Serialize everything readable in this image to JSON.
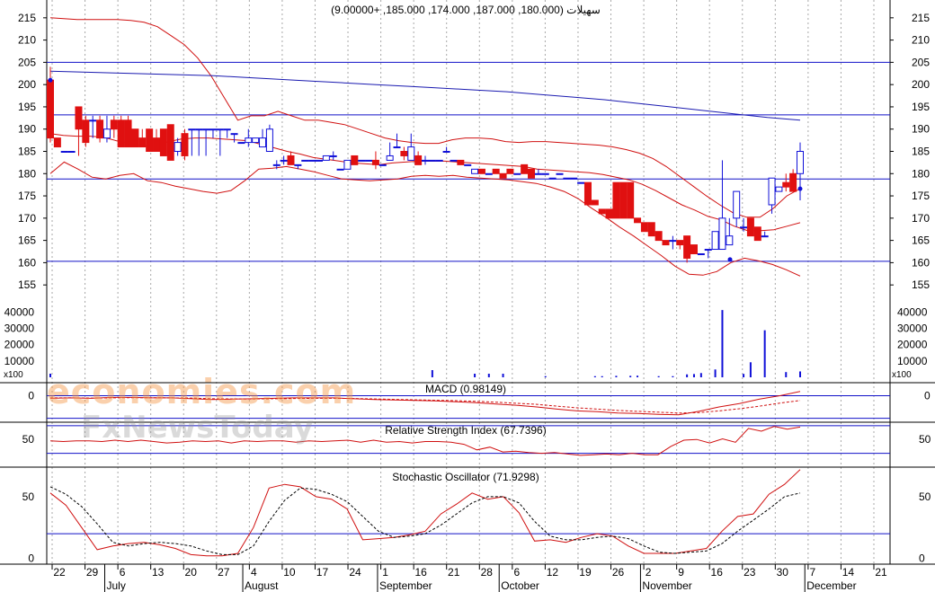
{
  "chart_data": {
    "type": "candlestick",
    "title": "سهیلات (180.000, 187.000, 174.000, 185.000, +9.00000)",
    "price": {
      "ylim": [
        151,
        219
      ],
      "ticks": [
        155,
        160,
        165,
        170,
        175,
        180,
        185,
        190,
        195,
        200,
        205,
        210,
        215
      ],
      "hlines": [
        205,
        193.2,
        178.8,
        160.3
      ],
      "candles": [
        [
          201,
          204,
          187,
          188
        ],
        [
          188,
          188,
          186,
          186
        ],
        [
          185,
          185,
          185,
          185
        ],
        [
          185,
          185,
          185,
          185
        ],
        [
          195,
          195,
          184,
          190
        ],
        [
          192,
          193,
          186,
          187
        ],
        [
          192,
          193,
          188,
          192
        ],
        [
          192,
          193,
          187,
          188
        ],
        [
          188,
          193,
          187,
          190
        ],
        [
          192,
          193,
          188,
          190
        ],
        [
          192,
          193,
          186,
          186
        ],
        [
          192,
          193,
          186,
          186
        ],
        [
          190,
          190,
          186,
          186
        ],
        [
          188,
          190,
          186,
          186
        ],
        [
          190,
          190,
          185,
          185
        ],
        [
          188,
          190,
          185,
          185
        ],
        [
          190,
          190,
          184,
          184
        ],
        [
          191,
          191,
          183,
          183
        ],
        [
          185,
          188,
          184,
          187
        ],
        [
          189,
          190,
          183,
          184
        ],
        [
          190,
          190,
          184,
          190
        ],
        [
          190,
          190,
          184,
          190
        ],
        [
          190,
          190,
          184,
          190
        ],
        [
          190,
          190,
          188,
          190
        ],
        [
          190,
          190,
          184,
          190
        ],
        [
          190,
          190,
          188,
          190
        ],
        [
          189,
          189,
          187,
          189
        ],
        [
          187,
          187,
          187,
          187
        ],
        [
          187,
          190,
          186,
          188
        ],
        [
          187,
          188,
          187,
          188
        ],
        [
          186,
          190,
          186,
          188
        ],
        [
          185,
          191,
          185,
          190
        ],
        [
          182,
          183,
          181,
          182
        ],
        [
          183,
          184,
          182,
          183
        ],
        [
          184,
          185,
          182,
          182
        ],
        [
          182,
          182,
          181,
          182
        ],
        [
          183,
          183,
          183,
          183
        ],
        [
          183,
          183,
          183,
          183
        ],
        [
          183,
          183,
          183,
          183
        ],
        [
          183,
          184,
          183,
          184
        ],
        [
          184,
          185,
          183,
          184
        ],
        [
          181,
          181,
          181,
          181
        ],
        [
          181,
          183,
          181,
          183
        ],
        [
          184,
          184,
          182,
          182
        ],
        [
          183,
          183,
          183,
          183
        ],
        [
          183,
          183,
          183,
          183
        ],
        [
          183,
          185,
          181,
          182
        ],
        [
          182,
          182,
          182,
          182
        ],
        [
          183,
          187,
          183,
          184
        ],
        [
          186,
          189,
          186,
          186
        ],
        [
          185,
          186,
          183,
          184
        ],
        [
          183,
          189,
          183,
          186
        ],
        [
          184,
          185,
          182,
          182
        ],
        [
          183,
          184,
          182,
          183
        ],
        [
          183,
          183,
          183,
          183
        ],
        [
          183,
          183,
          183,
          183
        ],
        [
          185,
          186,
          185,
          185
        ],
        [
          183,
          183,
          183,
          183
        ],
        [
          183,
          183,
          182,
          182
        ],
        [
          182,
          182,
          182,
          182
        ],
        [
          180,
          181,
          180,
          181
        ],
        [
          181,
          181,
          180,
          180
        ],
        [
          180,
          180,
          180,
          180
        ],
        [
          181,
          181,
          180,
          180
        ],
        [
          180,
          180,
          179,
          179
        ],
        [
          181,
          181,
          180,
          180
        ],
        [
          180,
          180,
          180,
          180
        ],
        [
          182,
          182,
          180,
          180
        ],
        [
          181,
          181,
          179,
          179
        ],
        [
          180,
          181,
          180,
          180
        ],
        [
          180,
          180,
          180,
          180
        ],
        [
          179,
          179,
          179,
          179
        ],
        [
          180,
          180,
          180,
          180
        ],
        [
          179,
          179,
          179,
          179
        ],
        [
          179,
          179,
          179,
          179
        ],
        [
          178,
          178,
          178,
          178
        ],
        [
          178,
          178,
          173,
          173
        ],
        [
          174,
          174,
          173,
          173
        ],
        [
          172,
          172,
          171,
          171
        ],
        [
          172,
          172,
          170,
          170
        ],
        [
          178,
          178,
          170,
          170
        ],
        [
          178,
          178,
          170,
          170
        ],
        [
          178,
          178,
          170,
          170
        ],
        [
          170,
          170,
          169,
          169
        ],
        [
          169,
          169,
          167,
          167
        ],
        [
          169,
          169,
          166,
          166
        ],
        [
          167,
          167,
          165,
          165
        ],
        [
          165,
          165,
          164,
          164
        ],
        [
          165,
          166,
          163,
          165
        ],
        [
          165,
          165,
          163,
          164
        ],
        [
          166,
          166,
          160,
          161
        ],
        [
          164,
          164,
          162,
          162
        ],
        [
          162,
          162,
          162,
          162
        ],
        [
          163,
          163,
          161,
          163
        ],
        [
          163,
          167,
          163,
          167
        ],
        [
          163,
          183,
          163,
          170
        ],
        [
          164,
          170,
          164,
          166
        ],
        [
          170,
          176,
          168,
          176
        ],
        [
          168,
          170,
          167,
          168
        ],
        [
          170,
          170,
          166,
          166
        ],
        [
          168,
          168,
          165,
          165
        ],
        [
          166,
          167,
          166,
          166
        ],
        [
          173,
          179,
          171,
          179
        ],
        [
          176,
          177,
          176,
          177
        ],
        [
          178,
          180,
          176,
          177
        ],
        [
          180,
          181,
          176,
          176
        ],
        [
          180,
          187,
          174,
          185
        ]
      ],
      "upper_band": [
        215,
        214.8,
        214.6,
        214.6,
        214.6,
        214.6,
        214.4,
        214,
        213,
        211,
        209,
        206,
        202,
        197,
        192,
        193,
        193,
        194,
        193,
        192,
        192,
        191.5,
        191,
        190,
        189,
        188,
        187.4,
        187,
        186.8,
        186.8,
        187.6,
        188,
        188,
        187.8,
        187.2,
        187,
        187.2,
        187.2,
        187,
        186.8,
        186.6,
        186.4,
        186,
        185.4,
        184.6,
        183.4,
        181.6,
        179.4,
        177.2,
        175,
        173,
        171.2,
        170.2,
        170.2,
        172.2,
        175,
        176.6
      ],
      "middle_band": [
        189,
        188.6,
        188.4,
        188.4,
        188.2,
        187.4,
        186.8,
        186.2,
        186.4,
        187.2,
        187.8,
        188,
        188,
        187.8,
        187.6,
        187.4,
        186.6,
        185.8,
        185,
        184.4,
        183.6,
        183.2,
        182.8,
        182.4,
        182.2,
        182,
        182.4,
        182.6,
        182.8,
        182.8,
        182.8,
        182.6,
        182.4,
        182.2,
        182,
        181.8,
        181.6,
        181,
        180.8,
        180.6,
        180.4,
        180.2,
        179.8,
        179.2,
        178.6,
        177.6,
        176.2,
        174.6,
        173,
        171.8,
        170.4,
        169.6,
        168.2,
        167.2,
        167.2,
        167.4,
        168.2,
        169
      ],
      "lower_band": [
        180,
        182.6,
        181,
        179.2,
        178.8,
        179.6,
        180,
        178.4,
        178,
        177.2,
        176.6,
        176,
        175.6,
        176.2,
        178.4,
        181,
        181.2,
        181.6,
        181,
        180.4,
        179.6,
        178.8,
        178.6,
        178.4,
        178.6,
        178.8,
        179.4,
        179.6,
        179.4,
        179.6,
        179.2,
        179,
        178.8,
        178.6,
        178.2,
        177.8,
        177,
        176,
        174.4,
        172.2,
        170.2,
        168,
        166,
        163.8,
        161.6,
        159.2,
        157.4,
        157.2,
        158,
        160,
        161,
        160.4,
        159.6,
        158.4,
        157
      ],
      "moving_average": [
        203,
        202.8,
        202.6,
        202.4,
        202.2,
        202,
        201.6,
        201.2,
        200.8,
        200.4,
        200,
        199.6,
        199.2,
        198.8,
        198.4,
        197.8,
        197.2,
        196.6,
        195.8,
        195,
        194.2,
        193.4,
        192.6,
        192
      ]
    },
    "volume": {
      "unit": "x100",
      "ticks": [
        10000,
        20000,
        30000,
        40000
      ],
      "ymax": 44000,
      "spikes": [
        [
          0,
          2200
        ],
        [
          54,
          4400
        ],
        [
          60,
          2200
        ],
        [
          62,
          2200
        ],
        [
          64,
          2200
        ],
        [
          70,
          700
        ],
        [
          77,
          700
        ],
        [
          78,
          700
        ],
        [
          80,
          900
        ],
        [
          82,
          900
        ],
        [
          83,
          1000
        ],
        [
          86,
          700
        ],
        [
          88,
          700
        ],
        [
          90,
          1800
        ],
        [
          91,
          2000
        ],
        [
          92,
          2600
        ],
        [
          94,
          4800
        ],
        [
          95,
          41200
        ],
        [
          98,
          2100
        ],
        [
          99,
          9200
        ],
        [
          101,
          28800
        ],
        [
          104,
          3200
        ],
        [
          106,
          3600
        ]
      ]
    },
    "macd": {
      "label": "MACD (0.98149)",
      "ylim": [
        -5.7,
        3.0
      ],
      "ticks": [
        0
      ],
      "hlines": [
        0,
        -5.2
      ],
      "macd": [
        -0.6,
        -0.5,
        -0.6,
        -0.4,
        -0.4,
        -0.5,
        -0.5,
        -0.7,
        -0.9,
        -0.8,
        -0.7,
        -0.6,
        -0.5,
        -0.5,
        -0.5,
        -0.7,
        -0.9,
        -1,
        -1.1,
        -1.2,
        -1.4,
        -1.6,
        -1.9,
        -2.2,
        -2.6,
        -3.1,
        -3.5,
        -3.7,
        -4,
        -4.1,
        -4.3,
        -4.4,
        -3.6,
        -2.6,
        -1.8,
        -0.8,
        0,
        0.98
      ],
      "signal": [
        -0.5,
        -0.5,
        -0.55,
        -0.5,
        -0.45,
        -0.45,
        -0.5,
        -0.55,
        -0.7,
        -0.75,
        -0.75,
        -0.7,
        -0.65,
        -0.6,
        -0.6,
        -0.65,
        -0.75,
        -0.85,
        -0.95,
        -1.05,
        -1.15,
        -1.3,
        -1.5,
        -1.75,
        -2,
        -2.4,
        -2.8,
        -3.1,
        -3.4,
        -3.6,
        -3.8,
        -4,
        -3.9,
        -3.5,
        -3,
        -2.4,
        -1.7,
        -1.1
      ]
    },
    "rsi": {
      "label": "Relative Strength Index (67.7396)",
      "ylim": [
        10,
        75
      ],
      "ticks": [
        50
      ],
      "hlines": [
        70,
        30
      ],
      "values": [
        48,
        47,
        48,
        48,
        47,
        49,
        47,
        49,
        47,
        45,
        46,
        48,
        47,
        48,
        45,
        48,
        47,
        48,
        48,
        46,
        48,
        47,
        48,
        49,
        46,
        49,
        46,
        47,
        45,
        47,
        47,
        46,
        43,
        35,
        39,
        32,
        33,
        31,
        30,
        31,
        29,
        27,
        28,
        29,
        28,
        30,
        28,
        28,
        40,
        49,
        50,
        45,
        51,
        46,
        66,
        62,
        69,
        65,
        68
      ]
    },
    "stochastic": {
      "label": "Stochastic Oscillator (71.9298)",
      "ylim": [
        -4,
        74
      ],
      "ticks": [
        0,
        50
      ],
      "hlines": [
        20
      ],
      "k": [
        53,
        43,
        25,
        7,
        10,
        12,
        13,
        11,
        8,
        3,
        2,
        2,
        4,
        25,
        57,
        60,
        58,
        50,
        48,
        40,
        15,
        16,
        17,
        19,
        22,
        36,
        44,
        53,
        48,
        50,
        37,
        14,
        15,
        13,
        17,
        20,
        18,
        10,
        4,
        4,
        4,
        6,
        8,
        22,
        34,
        36,
        52,
        60,
        72
      ],
      "d": [
        58,
        52,
        42,
        28,
        13,
        10,
        12,
        13,
        12,
        10,
        6,
        3,
        3,
        10,
        30,
        47,
        57,
        56,
        52,
        46,
        34,
        22,
        17,
        18,
        20,
        27,
        36,
        45,
        50,
        50,
        45,
        30,
        18,
        15,
        15,
        17,
        18,
        16,
        10,
        5,
        4,
        5,
        6,
        12,
        22,
        31,
        40,
        50,
        53
      ]
    },
    "x_axis": {
      "day_ticks": [
        "22",
        "29",
        "6",
        "13",
        "20",
        "27",
        "4",
        "10",
        "17",
        "24",
        "1",
        "16",
        "21",
        "28",
        "6",
        "12",
        "19",
        "26",
        "2",
        "9",
        "16",
        "23",
        "30",
        "7",
        "14",
        "21"
      ],
      "month_labels": [
        "July",
        "August",
        "September",
        "October",
        "November",
        "December"
      ],
      "volume_unit_label": "x100"
    },
    "watermark": {
      "line1": "economies.com",
      "line2": "FxNewsToday"
    }
  }
}
